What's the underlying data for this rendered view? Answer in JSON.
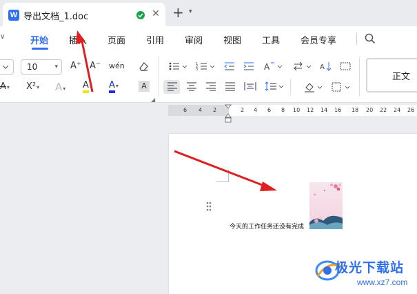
{
  "tab": {
    "app_logo": "W",
    "title": "导出文档_1.doc",
    "close_label": "✕",
    "new_tab_label": "+",
    "new_tab_menu_label": "▾",
    "saved_icon": "check-circle-icon"
  },
  "menu": {
    "chevron": "∨",
    "items": [
      "开始",
      "插入",
      "页面",
      "引用",
      "审阅",
      "视图",
      "工具",
      "会员专享"
    ],
    "active_index": 0,
    "search_icon": "search-icon"
  },
  "ribbon": {
    "font_size": "10",
    "row1": {
      "increase_font": "A⁺",
      "decrease_font": "A⁻",
      "phonetic": "wén",
      "eraser_icon": "eraser-icon",
      "bullets_icon": "bullet-list-icon",
      "numbering_icon": "numbered-list-icon",
      "outdent_icon": "outdent-icon",
      "indent_icon": "indent-icon",
      "text_direction_icon": "text-direction-icon",
      "swap_icon": "swap-icon",
      "sort_icon": "sort-icon",
      "border_icon": "border-icon"
    },
    "row2": {
      "strike": "A",
      "superscript": "X²",
      "text_effect": "A",
      "highlight": "A",
      "font_color": "A",
      "char_shading": "A",
      "align_left_icon": "align-left-icon",
      "align_center_icon": "align-center-icon",
      "align_right_icon": "align-right-icon",
      "justify_icon": "justify-icon",
      "distributed_icon": "distributed-icon",
      "line_spacing_icon": "line-spacing-icon",
      "shading_icon": "shading-icon",
      "borders_icon": "borders-icon"
    },
    "style_label": "正文",
    "colors": {
      "highlight": "#f5e100",
      "font_color": "#1c2fd8",
      "accent": "#2f6ff2"
    }
  },
  "ruler": {
    "left_numbers": [
      "6",
      "4",
      "2"
    ],
    "right_numbers": [
      "2",
      "4",
      "6",
      "8",
      "10",
      "12",
      "14",
      "16",
      "18",
      "20",
      "22",
      "24",
      "26"
    ]
  },
  "document": {
    "body_text": "今天的工作任务还没有完成"
  },
  "watermark": {
    "title": "极光下载站",
    "url": "www.xz7.com"
  }
}
